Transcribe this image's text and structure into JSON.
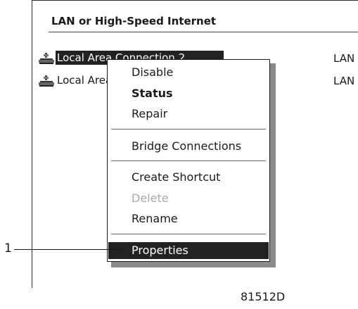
{
  "header": {
    "title": "LAN or High-Speed Internet"
  },
  "connections": [
    {
      "name": "Local Area Connection 2",
      "type": "LAN",
      "icon": "network-connection-icon",
      "selected": true
    },
    {
      "name": "Local Area Connection",
      "type": "LAN",
      "icon": "network-connection-icon",
      "selected": false
    }
  ],
  "context_menu": {
    "items": [
      {
        "label": "Disable"
      },
      {
        "label": "Status"
      },
      {
        "label": "Repair"
      },
      {
        "label": "Bridge Connections"
      },
      {
        "label": "Create Shortcut"
      },
      {
        "label": "Delete"
      },
      {
        "label": "Rename"
      },
      {
        "label": "Properties"
      }
    ]
  },
  "callout": {
    "label": "1"
  },
  "figure": {
    "code": "81512D"
  },
  "colors": {
    "highlight": "#222222",
    "text": "#1a1a1a",
    "disabled": "#a8a8a8"
  }
}
